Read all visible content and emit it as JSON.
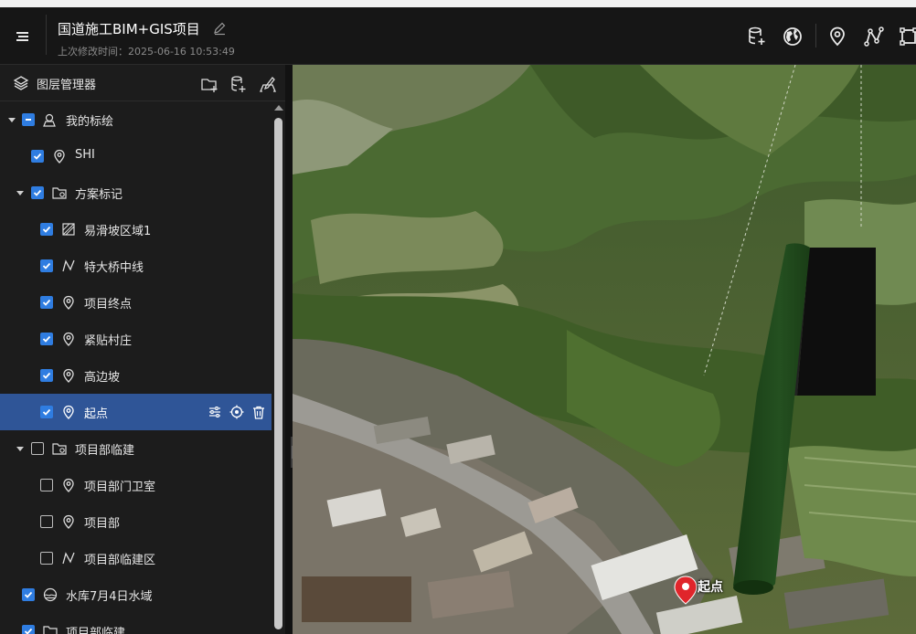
{
  "header": {
    "title": "国道施工BIM+GIS项目",
    "subtitle": "上次修改时间：2025-06-16 10:53:49"
  },
  "toolbar": {
    "icons": [
      "database-add-icon",
      "globe-icon",
      "location-pin-icon",
      "polyline-icon",
      "polygon-icon"
    ]
  },
  "panel": {
    "title": "图层管理器",
    "actions": [
      "add-folder-icon",
      "add-layer-icon",
      "edit-layers-icon"
    ]
  },
  "tree": [
    {
      "label": "我的标绘",
      "icon": "user-marker-icon",
      "check": "indeterminate",
      "caret": true,
      "level": 0
    },
    {
      "label": "SHI",
      "icon": "location-pin-icon",
      "check": "on",
      "caret": false,
      "level": 1
    },
    {
      "label": "方案标记",
      "icon": "folder-icon",
      "check": "on",
      "caret": true,
      "level": 1
    },
    {
      "label": "易滑坡区域1",
      "icon": "polygon-area-icon",
      "check": "on",
      "caret": false,
      "level": 2
    },
    {
      "label": "特大桥中线",
      "icon": "polyline-icon",
      "check": "on",
      "caret": false,
      "level": 2
    },
    {
      "label": "项目终点",
      "icon": "location-pin-icon",
      "check": "on",
      "caret": false,
      "level": 2
    },
    {
      "label": "紧贴村庄",
      "icon": "location-pin-icon",
      "check": "on",
      "caret": false,
      "level": 2
    },
    {
      "label": "高边坡",
      "icon": "location-pin-icon",
      "check": "on",
      "caret": false,
      "level": 2
    },
    {
      "label": "起点",
      "icon": "location-pin-icon",
      "check": "on",
      "caret": false,
      "level": 2,
      "selected": true
    },
    {
      "label": "项目部临建",
      "icon": "folder-icon",
      "check": "off",
      "caret": true,
      "level": 1
    },
    {
      "label": "项目部门卫室",
      "icon": "location-pin-icon",
      "check": "off",
      "caret": false,
      "level": 2
    },
    {
      "label": "项目部",
      "icon": "location-pin-icon",
      "check": "off",
      "caret": false,
      "level": 2
    },
    {
      "label": "项目部临建区",
      "icon": "polyline-icon",
      "check": "off",
      "caret": false,
      "level": 2
    },
    {
      "label": "水库7月4日水域",
      "icon": "water-area-icon",
      "check": "on",
      "caret": false,
      "level": 0
    },
    {
      "label": "项目部临建",
      "icon": "folder-icon",
      "check": "on",
      "caret": false,
      "level": 0
    }
  ],
  "selected_row_actions": [
    "settings-icon",
    "locate-icon",
    "delete-icon"
  ],
  "map": {
    "marker_label": "起点",
    "marker_color": "#e0252b",
    "pillar_color": "#1f4a1a"
  },
  "colors": {
    "accent": "#2f7de1",
    "selected_row": "#2f5597"
  }
}
